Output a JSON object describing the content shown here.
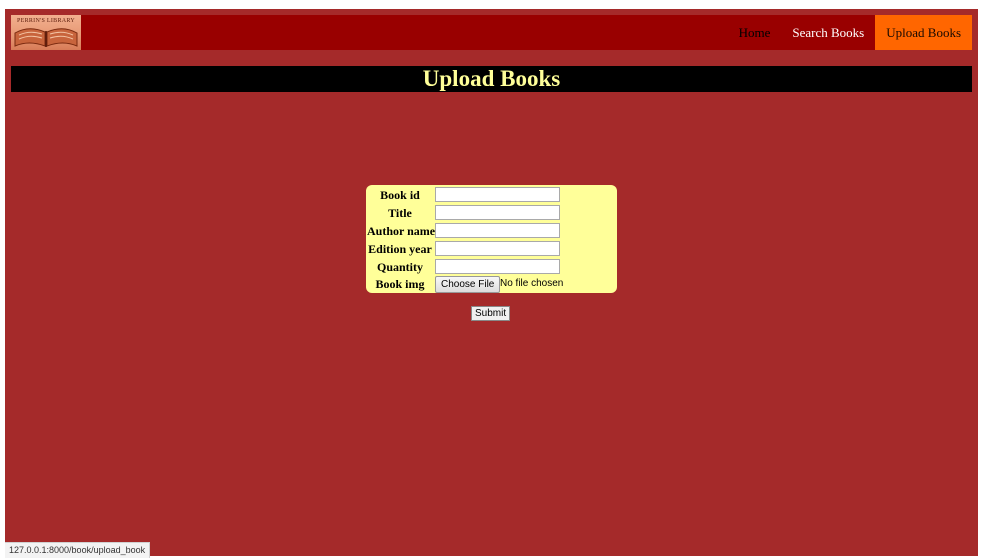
{
  "logo": {
    "text": "PERRIN'S LIBRARY"
  },
  "nav": {
    "links": [
      {
        "label": "Home"
      },
      {
        "label": "Search Books"
      },
      {
        "label": "Upload Books"
      }
    ],
    "active": "Upload Books"
  },
  "header": {
    "title": "Upload Books"
  },
  "form": {
    "fields": [
      {
        "label": "Book id",
        "value": ""
      },
      {
        "label": "Title",
        "value": ""
      },
      {
        "label": "Author name",
        "value": ""
      },
      {
        "label": "Edition year",
        "value": ""
      },
      {
        "label": "Quantity",
        "value": ""
      }
    ],
    "file": {
      "label": "Book img",
      "button_label": "Choose File",
      "status": "No file chosen"
    },
    "submit_label": "Submit"
  },
  "status_bar": {
    "url": "127.0.0.1:8000/book/upload_book"
  },
  "colors": {
    "page_bg": "#a52a2a",
    "navbar_bg": "#990000",
    "active_nav_bg": "#ff6600",
    "header_bg": "#000000",
    "title_color": "#ffff99",
    "form_bg": "#ffff99"
  },
  "icons": {
    "logo": "open-book-icon"
  }
}
